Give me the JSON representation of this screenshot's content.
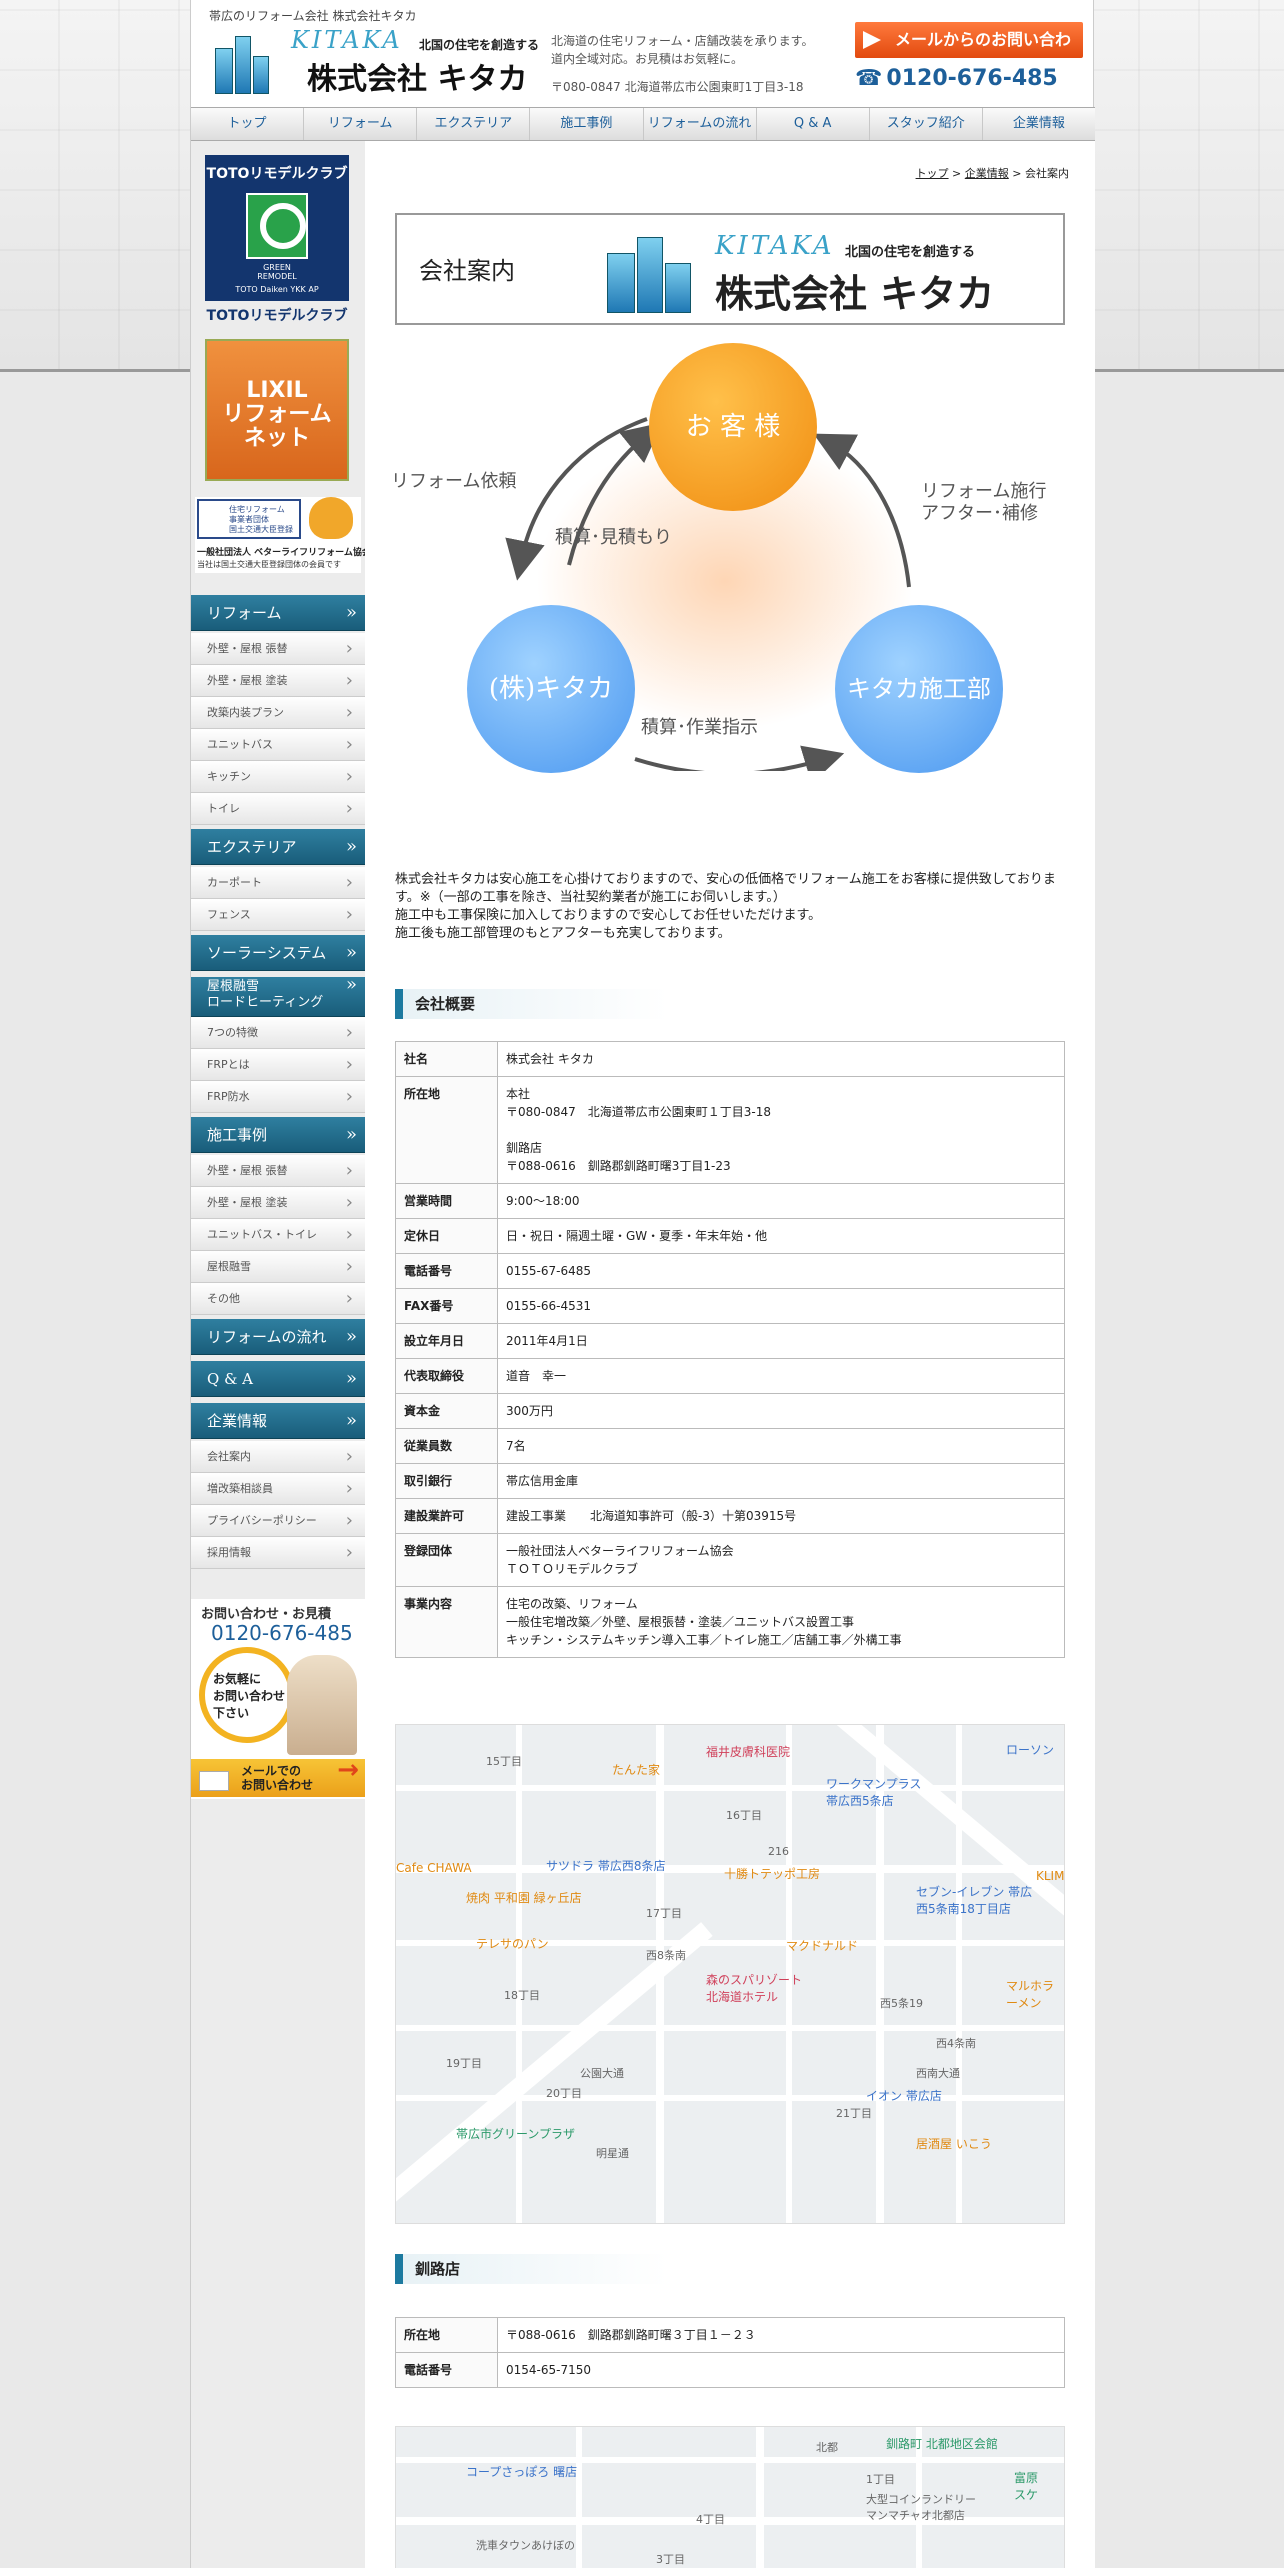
{
  "header": {
    "tagline": "帯広のリフォーム会社 株式会社キタカ",
    "logo_kitaka": "KITAKA",
    "logo_sub": "北国の住宅を創造する",
    "logo_name": "株式会社 キタカ",
    "desc1": "北海道の住宅リフォーム・店舗改装を承ります。",
    "desc2": "道内全域対応。お見積はお気軽に。",
    "address": "〒080-0847  北海道帯広市公園東町1丁目3-18",
    "mail_button": "メールからのお問い合わせ",
    "tel": "0120-676-485"
  },
  "nav": [
    "トップ",
    "リフォーム",
    "エクステリア",
    "施工事例",
    "リフォームの流れ",
    "Q & A",
    "スタッフ紹介",
    "企業情報"
  ],
  "sidebar": {
    "banner1_title": "TOTOリモデルクラブ",
    "banner1_green": "GREEN\nREMODEL",
    "banner1_brand": "TOTO  Daiken  YKK AP",
    "banner1_caption": "TOTOリモデルクラブ",
    "banner2": "LIXIL\nリフォーム\nネット",
    "banner3_box": "住宅リフォーム\n事業者団体\n国土交通大臣登録",
    "banner3_t1": "一般社団法人 ベターライフリフォーム協会",
    "banner3_t2": "当社は国土交通大臣登録団体の会員です",
    "menu": [
      {
        "head": "リフォーム",
        "items": [
          "外壁・屋根 張替",
          "外壁・屋根 塗装",
          "改築内装プラン",
          "ユニットバス",
          "キッチン",
          "トイレ"
        ]
      },
      {
        "head": "エクステリア",
        "items": [
          "カーポート",
          "フェンス"
        ]
      },
      {
        "head": "ソーラーシステム",
        "items": []
      },
      {
        "head": "屋根融雪\nロードヒーティング",
        "items": [
          "7つの特徴",
          "FRPとは",
          "FRP防水"
        ]
      },
      {
        "head": "施工事例",
        "items": [
          "外壁・屋根 張替",
          "外壁・屋根 塗装",
          "ユニットバス・トイレ",
          "屋根融雪",
          "その他"
        ]
      },
      {
        "head": "リフォームの流れ",
        "items": []
      },
      {
        "head": "Q & A",
        "items": []
      },
      {
        "head": "企業情報",
        "items": [
          "会社案内",
          "増改築相談員",
          "プライバシーポリシー",
          "採用情報"
        ]
      }
    ],
    "contact_title": "お問い合わせ・お見積",
    "contact_tel": "0120-676-485",
    "contact_msg": "お気軽に\nお問い合わせ\n下さい",
    "contact_mail": "メールでの\nお問い合わせ"
  },
  "breadcrumb": {
    "top": "トップ",
    "company": "企業情報",
    "current": "会社案内"
  },
  "title_box": {
    "label": "会社案内",
    "kitaka": "KITAKA",
    "sub": "北国の住宅を創造する",
    "name": "株式会社 キタカ"
  },
  "diagram": {
    "customer": "お 客 様",
    "kitaka": "(株)キタカ",
    "dept": "キタカ施工部",
    "reform_request": "リフォーム依頼",
    "estimate": "積算･見積もり",
    "construction": "リフォーム施行\nアフター･補修",
    "instruction": "積算･作業指示"
  },
  "intro": "株式会社キタカは安心施工を心掛けておりますので、安心の低価格でリフォーム施工をお客様に提供致しております。※（一部の工事を除き、当社契約業者が施工にお伺いします。）\n施工中も工事保険に加入しておりますので安心してお任せいただけます。\n施工後も施工部管理のもとアフターも充実しております。",
  "overview": {
    "heading": "会社概要",
    "rows": [
      {
        "k": "社名",
        "v": "株式会社 キタカ"
      },
      {
        "k": "所在地",
        "v": "本社\n〒080-0847　北海道帯広市公園東町１丁目3-18\n\n釧路店\n〒088-0616　釧路郡釧路町曙3丁目1-23"
      },
      {
        "k": "営業時間",
        "v": "9:00～18:00"
      },
      {
        "k": "定休日",
        "v": "日・祝日・隔週土曜・GW・夏季・年末年始・他"
      },
      {
        "k": "電話番号",
        "v": "0155-67-6485"
      },
      {
        "k": "FAX番号",
        "v": "0155-66-4531"
      },
      {
        "k": "設立年月日",
        "v": "2011年4月1日"
      },
      {
        "k": "代表取締役",
        "v": "道音　幸一"
      },
      {
        "k": "資本金",
        "v": "300万円"
      },
      {
        "k": "従業員数",
        "v": "7名"
      },
      {
        "k": "取引銀行",
        "v": "帯広信用金庫"
      },
      {
        "k": "建設業許可",
        "v": "建設工事業　　北海道知事許可（般-3）十第03915号"
      },
      {
        "k": "登録団体",
        "v": "一般社団法人ベターライフリフォーム協会\nＴＯＴＯリモデルクラブ"
      },
      {
        "k": "事業内容",
        "v": "住宅の改築、リフォーム\n一般住宅増改築／外壁、屋根張替・塗装／ユニットバス設置工事\nキッチン・システムキッチン導入工事／トイレ施工／店舗工事／外構工事"
      }
    ]
  },
  "map1": {
    "pins": [
      {
        "t": "福井皮膚科医院",
        "c": "r"
      },
      {
        "t": "たんた家",
        "c": "o"
      },
      {
        "t": "ワークマンプラス\n帯広西5条店",
        "c": "b"
      },
      {
        "t": "サツドラ 帯広西8条店",
        "c": "b"
      },
      {
        "t": "十勝トテッポ工房",
        "c": "o"
      },
      {
        "t": "焼肉 平和園 緑ヶ丘店",
        "c": "o"
      },
      {
        "t": "テレサのパン",
        "c": "o"
      },
      {
        "t": "マクドナルド",
        "c": "o"
      },
      {
        "t": "森のスパリゾート\n北海道ホテル",
        "c": "r"
      },
      {
        "t": "セブン-イレブン 帯広\n西5条南18丁目店",
        "c": "b"
      },
      {
        "t": "帯広市グリーンプラザ",
        "c": "g"
      },
      {
        "t": "イオン 帯広店",
        "c": "b"
      },
      {
        "t": "居酒屋 いこう",
        "c": "o"
      },
      {
        "t": "Cafe CHAWA",
        "c": "o"
      },
      {
        "t": "ローソン",
        "c": "b"
      },
      {
        "t": "マルホラーメン",
        "c": "o"
      },
      {
        "t": "KLIM",
        "c": "o"
      }
    ],
    "labels": [
      "15丁目",
      "16丁目",
      "17丁目",
      "18丁目",
      "19丁目",
      "20丁目",
      "21丁目",
      "西8条南",
      "西4条南",
      "西5条19",
      "西南大通",
      "公園大通",
      "明星通",
      "216"
    ]
  },
  "kushiro": {
    "heading": "釧路店",
    "rows": [
      {
        "k": "所在地",
        "v": "〒088-0616　釧路郡釧路町曙３丁目１－２３"
      },
      {
        "k": "電話番号",
        "v": "0154-65-7150"
      }
    ]
  },
  "map2": {
    "pins": [
      {
        "t": "釧路町 北都地区会館",
        "c": "g"
      },
      {
        "t": "コープさっぽろ 曙店",
        "c": "b"
      },
      {
        "t": "大型コインランドリー\nマンマチャオ北都店",
        "c": "gy"
      },
      {
        "t": "洗車タウンあけぼの",
        "c": "gy"
      },
      {
        "t": "富原\nスケ",
        "c": "g"
      }
    ],
    "labels": [
      "北都",
      "1丁目",
      "3丁目",
      "4丁目"
    ]
  }
}
